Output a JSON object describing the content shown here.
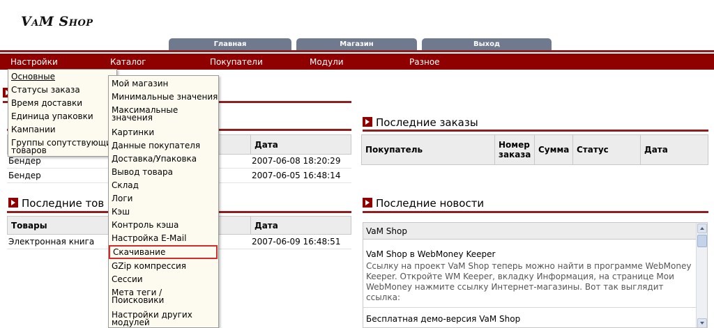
{
  "logo": "VaM Shop",
  "top_tabs": [
    "Главная",
    "Магазин",
    "Выход"
  ],
  "menu": [
    "Настройки",
    "Каталог",
    "Покупатели",
    "Модули",
    "Разное"
  ],
  "settings_dropdown": [
    "Основные",
    "Статусы заказа",
    "Время доставки",
    "Единица упаковки",
    "Кампании",
    "Группы сопутствующих товаров"
  ],
  "catalog_dropdown": [
    "Мой магазин",
    "Минимальные значения",
    "Максимальные значения",
    "Картинки",
    "Данные покупателя",
    "Доставка/Упаковка",
    "Вывод товара",
    "Склад",
    "Логи",
    "Кэш",
    "Контроль кэша",
    "Настройка E-Mail",
    "Скачивание",
    "GZip компрессия",
    "Сессии",
    "Мета теги / Поисковики",
    "Настройки других модулей"
  ],
  "left_customers": {
    "col_date": "Дата",
    "rows": [
      {
        "name": "Бендер",
        "date": "2007-06-08 18:20:29"
      },
      {
        "name": "Бендер",
        "date": "2007-06-05 16:48:14"
      }
    ]
  },
  "last_products": {
    "title": "Последние тов",
    "col_product": "Товары",
    "col_date": "Дата",
    "rows": [
      {
        "name": "Электронная книга",
        "date": "2007-06-09 16:48:51"
      }
    ]
  },
  "last_orders": {
    "title": "Последние заказы",
    "columns": [
      "Покупатель",
      "Номер заказа",
      "Сумма",
      "Статус",
      "Дата"
    ]
  },
  "last_news": {
    "title": "Последние новости",
    "header": "VaM Shop",
    "item1_title": "VaM Shop в WebMoney Keeper",
    "item1_text": "Ссылку на проект VaM Shop теперь можно найти в программе WebMoney Keeper. Откройте WM Keeper, вкладку Информация, на странице Мои WebMoney нажмите ссылку Интернет-магазины. Вот так выглядит ссылка:",
    "item2_title": "Бесплатная демо-версия VaM Shop"
  },
  "colors": {
    "brand": "#8f0000",
    "tab": "#6f7a8f",
    "dropdown_bg": "#fdfbef",
    "highlight": "#d42a2a"
  }
}
